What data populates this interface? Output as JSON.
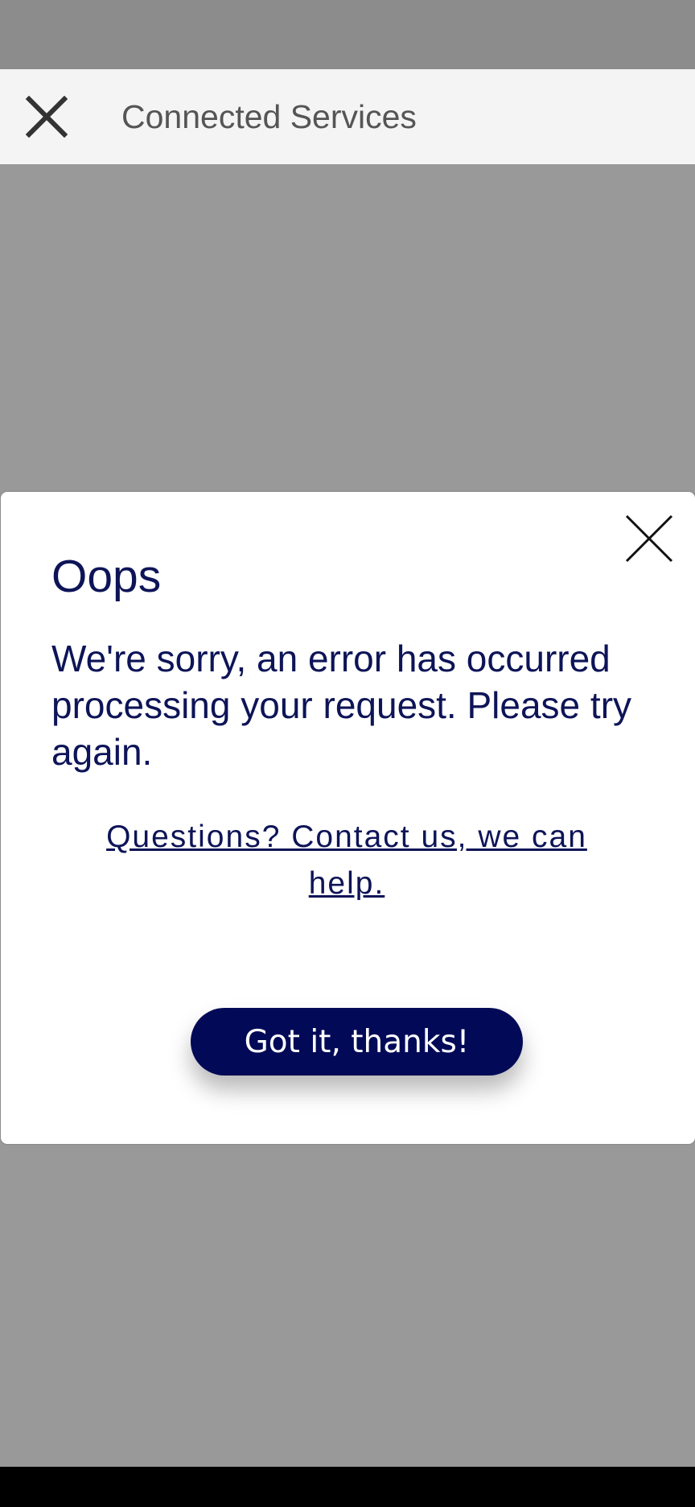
{
  "header": {
    "title": "Connected Services",
    "close_icon": "close-icon"
  },
  "dialog": {
    "close_icon": "close-icon",
    "title": "Oops",
    "message": "We're sorry, an error has occurred processing your request. Please try again.",
    "contact_link": "Questions? Contact us, we can help.",
    "confirm_button": "Got it, thanks!"
  },
  "colors": {
    "brand_navy": "#020a57",
    "text_navy": "#0d1457",
    "header_bg": "#f4f4f4",
    "backdrop": "#999999"
  }
}
